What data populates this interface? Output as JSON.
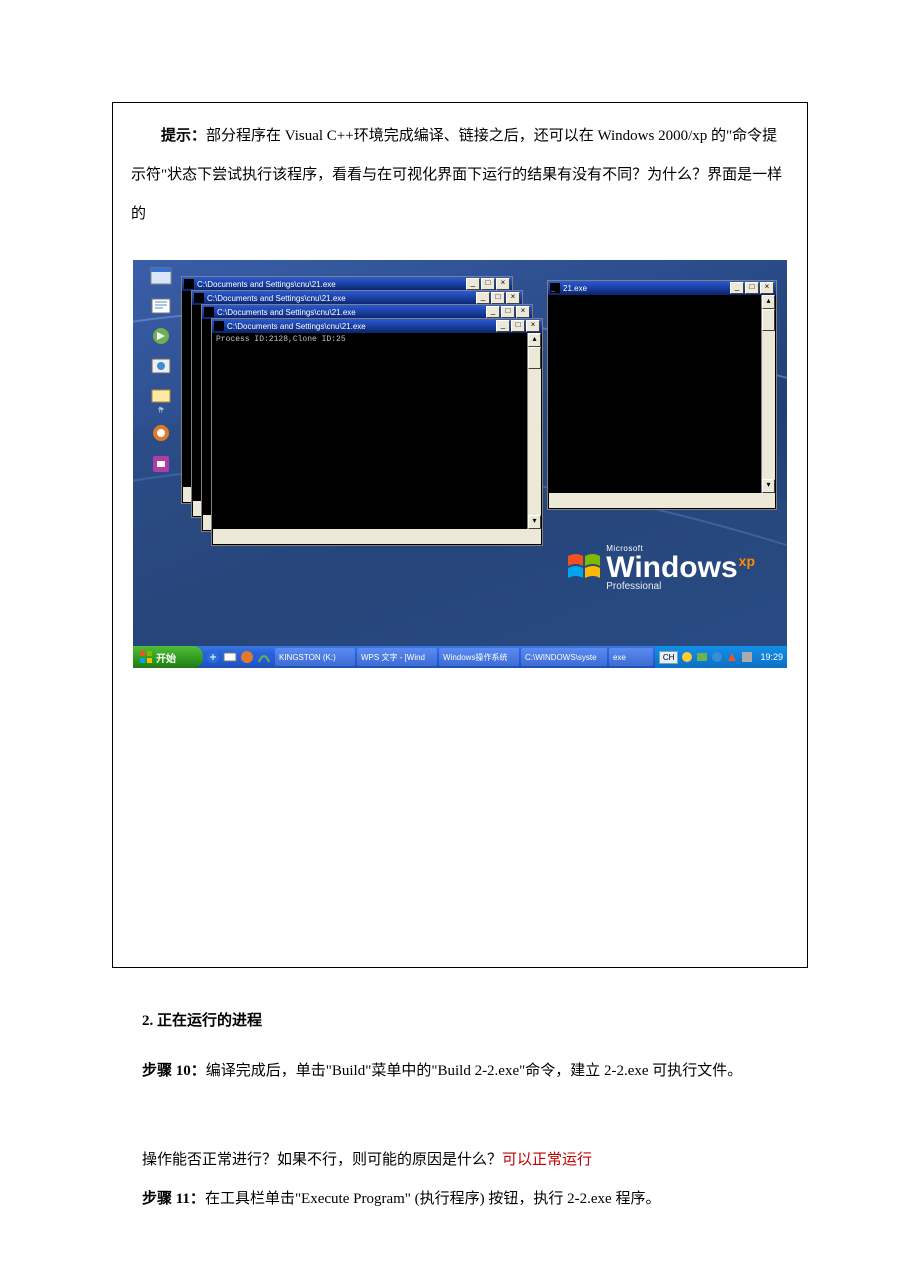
{
  "box": {
    "tip_label": "提示：",
    "tip_text_after_label": "部分程序在 Visual C++环境完成编译、链接之后，还可以在 Windows 2000/xp 的\"命令提示符\"状态下尝试执行该程序，看看与在可视化界面下运行的结果有没有不同？为什么？界面是一样的"
  },
  "shot": {
    "console_titles": [
      "C:\\Documents and Settings\\cnu\\21.exe",
      "C:\\Documents and Settings\\cnu\\21.exe",
      "C:\\Documents and Settings\\cnu\\21.exe",
      "C:\\Documents and Settings\\cnu\\21.exe"
    ],
    "right_console_title": "21.exe",
    "console_output_line": "Process ID:2128,Clone ID:25",
    "taskbar": {
      "start": "开始",
      "items": [
        "KINGSTON  (K:)",
        "WPS 文字 - [Wind",
        "Windows操作系统",
        "C:\\WINDOWS\\syste",
        "exe"
      ],
      "lang": "CH",
      "clock": "19:29"
    },
    "logo": {
      "ms": "Microsoft",
      "win": "Windows",
      "xp": "xp",
      "pro": "Professional"
    },
    "desktop_labels": [
      "",
      "",
      "",
      "",
      "件",
      "",
      "",
      ""
    ]
  },
  "after": {
    "heading": "2.  正在运行的进程",
    "step10_label": "步骤 10：",
    "step10_text": "编译完成后，单击\"Build\"菜单中的\"Build 2-2.exe\"命令，建立 2-2.exe 可执行文件。",
    "q_text_before": "操作能否正常进行？如果不行，则可能的原因是什么？",
    "q_answer": "可以正常运行",
    "step11_label": "步骤 11：",
    "step11_text": "在工具栏单击\"Execute Program\"  (执行程序)  按钮，执行 2-2.exe 程序。"
  }
}
